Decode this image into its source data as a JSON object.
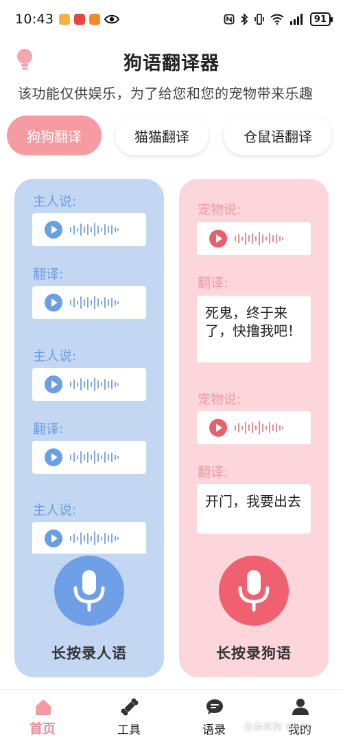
{
  "status_bar": {
    "time": "10:43",
    "battery": "91"
  },
  "header": {
    "title": "狗语翻译器",
    "subtitle": "该功能仅供娱乐，为了给您和您的宠物带来乐趣"
  },
  "tabs": [
    {
      "label": "狗狗翻译",
      "active": true
    },
    {
      "label": "猫猫翻译",
      "active": false
    },
    {
      "label": "仓鼠语翻译",
      "active": false
    }
  ],
  "left_panel": {
    "labels": [
      "主人说:",
      "翻译:",
      "主人说:",
      "翻译:",
      "主人说:"
    ],
    "mic_caption": "长按录人语"
  },
  "right_panel": {
    "labels": [
      "宠物说:",
      "翻译:",
      "宠物说:",
      "翻译:"
    ],
    "translations": [
      "死鬼，终于来了，快撸我吧！",
      "开门，我要出去"
    ],
    "mic_caption": "长按录狗语"
  },
  "bottom_nav": [
    {
      "label": "首页",
      "icon": "home-icon",
      "active": true
    },
    {
      "label": "工具",
      "icon": "bone-icon",
      "active": false
    },
    {
      "label": "语录",
      "icon": "chat-icon",
      "active": false
    },
    {
      "label": "我的",
      "icon": "user-icon",
      "active": false
    }
  ],
  "watermark": "云朵有狗 WUO",
  "colors": {
    "accent_pink": "#f59ba1",
    "panel_blue": "#c3d7f3",
    "panel_pink": "#fdd6dc",
    "mic_blue": "#6f9fe6",
    "mic_red": "#ef6170"
  }
}
